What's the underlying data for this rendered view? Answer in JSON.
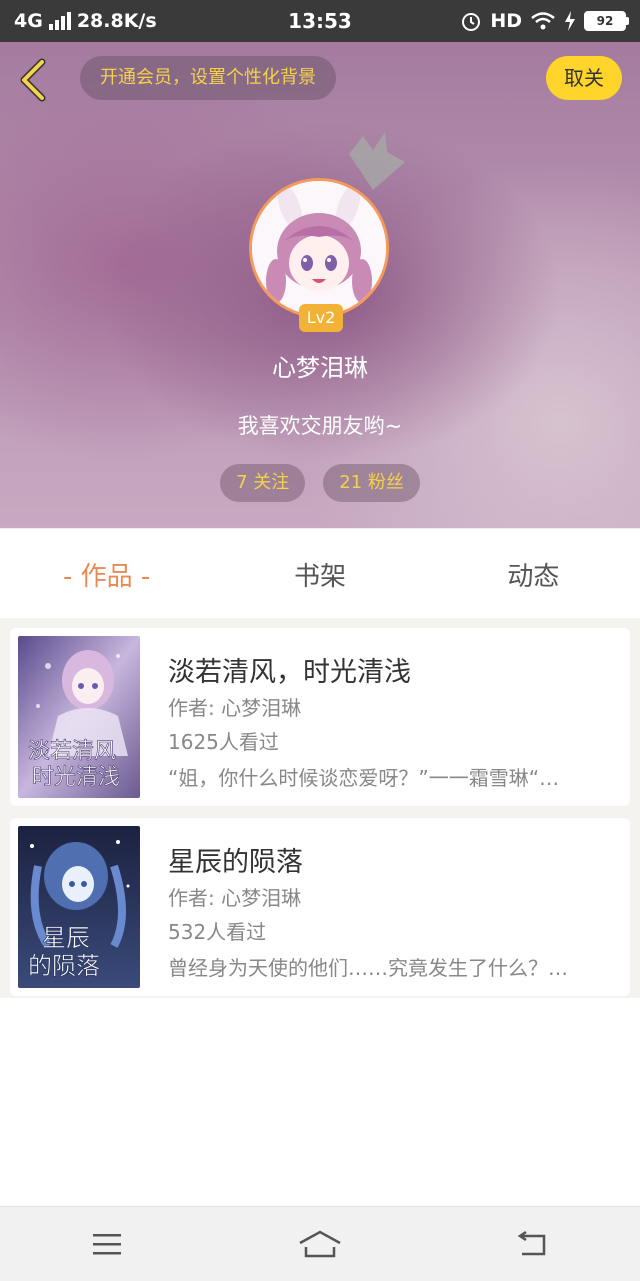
{
  "status_bar": {
    "network": "4G",
    "speed": "28.8K/s",
    "time": "13:53",
    "hd": "HD",
    "battery": "92"
  },
  "header": {
    "member_promo": "开通会员，设置个性化背景",
    "unfollow_label": "取关",
    "level": "Lv2",
    "username": "心梦泪琳",
    "bio": "我喜欢交朋友哟~",
    "following": "7 关注",
    "followers": "21 粉丝"
  },
  "tabs": [
    {
      "label": "- 作品 -",
      "active": true
    },
    {
      "label": "书架",
      "active": false
    },
    {
      "label": "动态",
      "active": false
    }
  ],
  "books": [
    {
      "title": "淡若清风，时光清浅",
      "author": "作者: 心梦泪琳",
      "views": "1625人看过",
      "desc": "“姐，你什么时候谈恋爱呀？”一一霜雪琳“…",
      "cover_text": "淡若清风时光清浅"
    },
    {
      "title": "星辰的陨落",
      "author": "作者: 心梦泪琳",
      "views": "532人看过",
      "desc": "曾经身为天使的他们……究竟发生了什么？…",
      "cover_text": "星辰的陨落"
    }
  ],
  "colors": {
    "accent": "#e98a56",
    "gold": "#f5d24a",
    "yellow_button": "#ffd52b"
  }
}
